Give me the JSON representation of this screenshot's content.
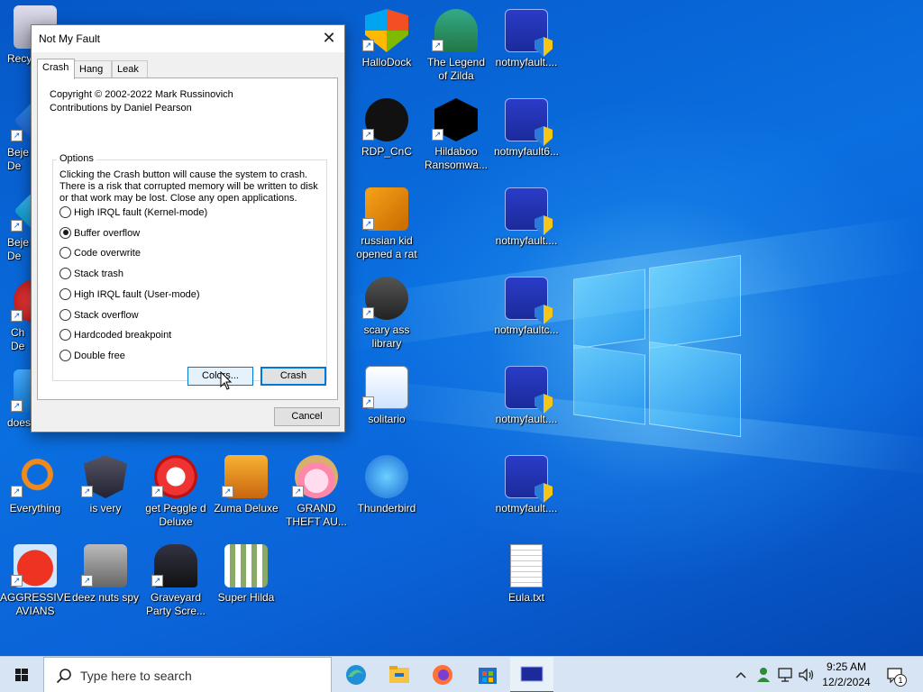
{
  "dialog": {
    "title": "Not My Fault",
    "close_glyph": "✕",
    "tabs": [
      {
        "label": "Crash",
        "active": true
      },
      {
        "label": "Hang",
        "active": false
      },
      {
        "label": "Leak",
        "active": false
      }
    ],
    "copyright": "Copyright © 2002-2022 Mark Russinovich",
    "contributions": "Contributions by Daniel Pearson",
    "options_legend": "Options",
    "options_description": "Clicking the Crash button will cause the system to crash. There is a risk that corrupted memory will be written to disk or that work may be lost. Close any open applications.",
    "radio_options": [
      {
        "label": "High IRQL fault (Kernel-mode)",
        "checked": false
      },
      {
        "label": "Buffer overflow",
        "checked": true
      },
      {
        "label": "Code overwrite",
        "checked": false
      },
      {
        "label": "Stack trash",
        "checked": false
      },
      {
        "label": "High IRQL fault (User-mode)",
        "checked": false
      },
      {
        "label": "Stack overflow",
        "checked": false
      },
      {
        "label": "Hardcoded breakpoint",
        "checked": false
      },
      {
        "label": "Double free",
        "checked": false
      }
    ],
    "colors_button": "Colors...",
    "crash_button": "Crash",
    "cancel_button": "Cancel"
  },
  "desktop": {
    "icons": [
      {
        "label": "Recy",
        "icon": "recycle-bin-icon"
      },
      {
        "label": "Beje\nDe",
        "icon": "bejeweled-icon"
      },
      {
        "label": "Beje\nDe",
        "icon": "bejeweled-icon"
      },
      {
        "label": "Ch\nDe",
        "icon": "chess-icon"
      },
      {
        "label": "does",
        "icon": "app-icon"
      },
      {
        "label": "HalloDock",
        "icon": "windows-shield-icon"
      },
      {
        "label": "The Legend\nof Zilda",
        "icon": "zilda-game-icon"
      },
      {
        "label": "notmyfault....",
        "icon": "bsod-icon"
      },
      {
        "label": "RDP_CnC",
        "icon": "rdp-icon"
      },
      {
        "label": "Hildaboo\nRansomwa...",
        "icon": "ransomware-icon"
      },
      {
        "label": "notmyfault6...",
        "icon": "bsod-icon"
      },
      {
        "label": "russian kid\nopened a rat",
        "icon": "de-icon"
      },
      {
        "label": "notmyfault....",
        "icon": "bsod-icon"
      },
      {
        "label": "scary ass\nlibrary",
        "icon": "library-icon"
      },
      {
        "label": "notmyfaultc...",
        "icon": "bsod-icon"
      },
      {
        "label": "solitario",
        "icon": "solitaire-icon"
      },
      {
        "label": "notmyfault....",
        "icon": "bsod-icon"
      },
      {
        "label": "Everything",
        "icon": "everything-search-icon"
      },
      {
        "label": "is very",
        "icon": "mpl-icon"
      },
      {
        "label": "get Peggle d\nDeluxe",
        "icon": "peggle-icon"
      },
      {
        "label": "Zuma Deluxe",
        "icon": "zuma-icon"
      },
      {
        "label": "GRAND\nTHEFT AU...",
        "icon": "anime-girl-icon"
      },
      {
        "label": "Thunderbird",
        "icon": "thunderbird-icon"
      },
      {
        "label": "notmyfault....",
        "icon": "bsod-icon"
      },
      {
        "label": "AGGRESSIVE\nAVIANS",
        "icon": "angry-bird-icon"
      },
      {
        "label": "deez nuts spy",
        "icon": "windows-stack-icon"
      },
      {
        "label": "Graveyard\nParty Scre...",
        "icon": "graveyard-icon"
      },
      {
        "label": "Super Hilda",
        "icon": "pixel-game-icon"
      },
      {
        "label": "Eula.txt",
        "icon": "text-file-icon"
      }
    ]
  },
  "taskbar": {
    "search_placeholder": "Type here to search",
    "apps": [
      "edge-icon",
      "file-explorer-icon",
      "firefox-icon",
      "store-icon",
      "notmyfault-icon"
    ],
    "time": "9:25 AM",
    "date": "12/2/2024",
    "notification_count": "1"
  }
}
